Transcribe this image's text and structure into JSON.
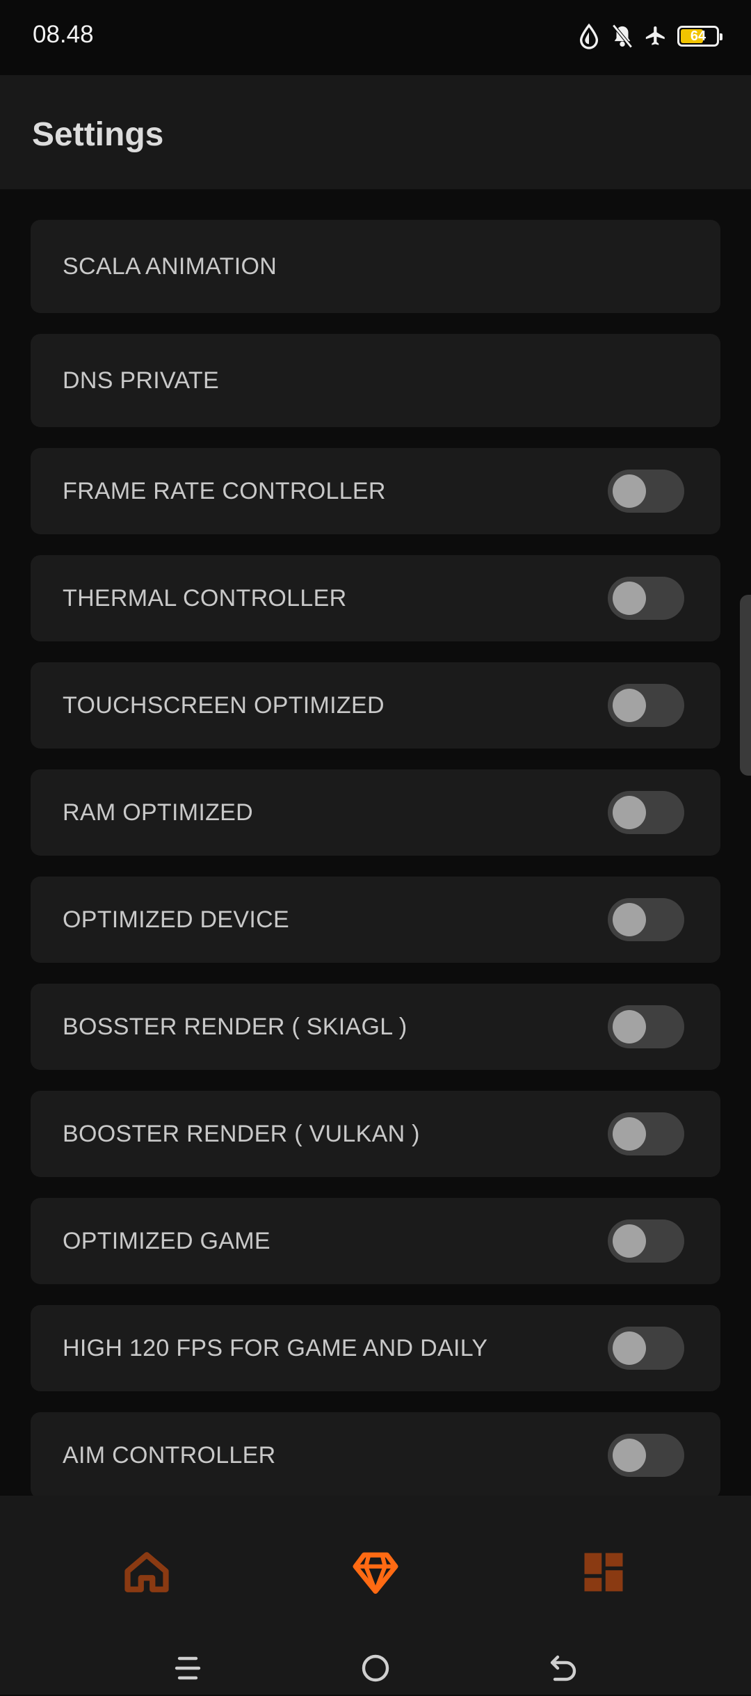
{
  "status": {
    "time": "08.48",
    "battery_level": "64"
  },
  "header": {
    "title": "Settings"
  },
  "settings": [
    {
      "label": "SCALA ANIMATION",
      "toggle": false
    },
    {
      "label": "DNS PRIVATE",
      "toggle": false
    },
    {
      "label": "FRAME RATE CONTROLLER",
      "toggle": true,
      "on": false
    },
    {
      "label": "THERMAL CONTROLLER",
      "toggle": true,
      "on": false
    },
    {
      "label": "TOUCHSCREEN OPTIMIZED",
      "toggle": true,
      "on": false
    },
    {
      "label": "RAM OPTIMIZED",
      "toggle": true,
      "on": false
    },
    {
      "label": "OPTIMIZED DEVICE",
      "toggle": true,
      "on": false
    },
    {
      "label": "BOSSTER RENDER ( SKIAGL )",
      "toggle": true,
      "on": false
    },
    {
      "label": "BOOSTER RENDER ( VULKAN )",
      "toggle": true,
      "on": false
    },
    {
      "label": "OPTIMIZED GAME",
      "toggle": true,
      "on": false
    },
    {
      "label": "HIGH 120 FPS FOR GAME AND DAILY",
      "toggle": true,
      "on": false
    },
    {
      "label": "AIM CONTROLLER",
      "toggle": true,
      "on": false
    }
  ],
  "bottom_nav": [
    {
      "icon": "home-icon",
      "active": false
    },
    {
      "icon": "diamond-icon",
      "active": true
    },
    {
      "icon": "dashboard-icon",
      "active": false
    }
  ],
  "system_nav": [
    "menu-icon",
    "home-circle-icon",
    "back-icon"
  ],
  "colors": {
    "accent": "#ff6a13",
    "accent_dim": "#8a3a12",
    "card_bg": "#1b1b1b",
    "page_bg": "#0c0c0c"
  }
}
